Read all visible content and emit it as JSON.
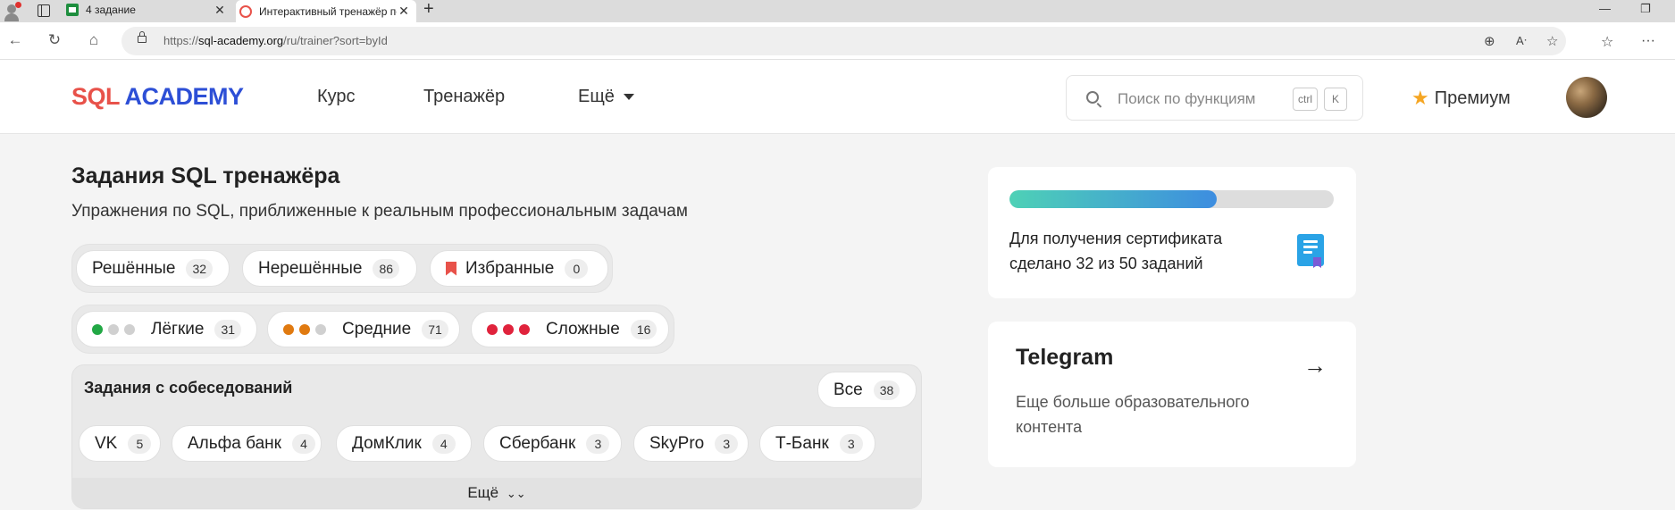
{
  "browser": {
    "tabs": [
      {
        "title": "4 задание",
        "icon": "sheets-icon"
      },
      {
        "title": "Интерактивный тренажёр по SQL",
        "icon": "sql-academy-icon",
        "active": true
      }
    ],
    "url_prefix": "https://",
    "url_host": "sql-academy.org",
    "url_path": "/ru/trainer?sort=byId"
  },
  "header": {
    "logo_sql": "SQL",
    "logo_academy": "ACADEMY",
    "nav": [
      "Курс",
      "Тренажёр",
      "Ещё"
    ],
    "search_placeholder": "Поиск по функциям",
    "kbd_ctrl": "ctrl",
    "kbd_k": "K",
    "premium": "Премиум"
  },
  "main": {
    "title": "Задания SQL тренажёра",
    "subtitle": "Упражнения по SQL, приближенные к реальным профессиональным задачам",
    "status_filters": [
      {
        "label": "Решённые",
        "count": "32"
      },
      {
        "label": "Нерешённые",
        "count": "86"
      },
      {
        "label": "Избранные",
        "count": "0"
      }
    ],
    "difficulty_filters": [
      {
        "label": "Лёгкие",
        "count": "31",
        "dots": [
          "#22a845",
          "#d0d0d0",
          "#d0d0d0"
        ]
      },
      {
        "label": "Средние",
        "count": "71",
        "dots": [
          "#e07a10",
          "#e07a10",
          "#d0d0d0"
        ]
      },
      {
        "label": "Сложные",
        "count": "16",
        "dots": [
          "#e0233c",
          "#e0233c",
          "#e0233c"
        ]
      }
    ],
    "interview": {
      "title": "Задания с собеседований",
      "all_label": "Все",
      "all_count": "38",
      "companies": [
        {
          "label": "VK",
          "count": "5"
        },
        {
          "label": "Альфа банк",
          "count": "4"
        },
        {
          "label": "ДомКлик",
          "count": "4"
        },
        {
          "label": "Сбербанк",
          "count": "3"
        },
        {
          "label": "SkyPro",
          "count": "3"
        },
        {
          "label": "Т-Банк",
          "count": "3"
        }
      ],
      "more_label": "Ещё"
    }
  },
  "sidebar": {
    "certificate": {
      "progress": 0.64,
      "text": "Для получения сертификата сделано 32 из 50 заданий"
    },
    "telegram": {
      "title": "Telegram",
      "subtitle": "Еще больше образовательного контента"
    }
  },
  "colors": {
    "brand_red": "#e8524a",
    "brand_blue": "#2d4fd6",
    "premium_star": "#f5a623"
  }
}
